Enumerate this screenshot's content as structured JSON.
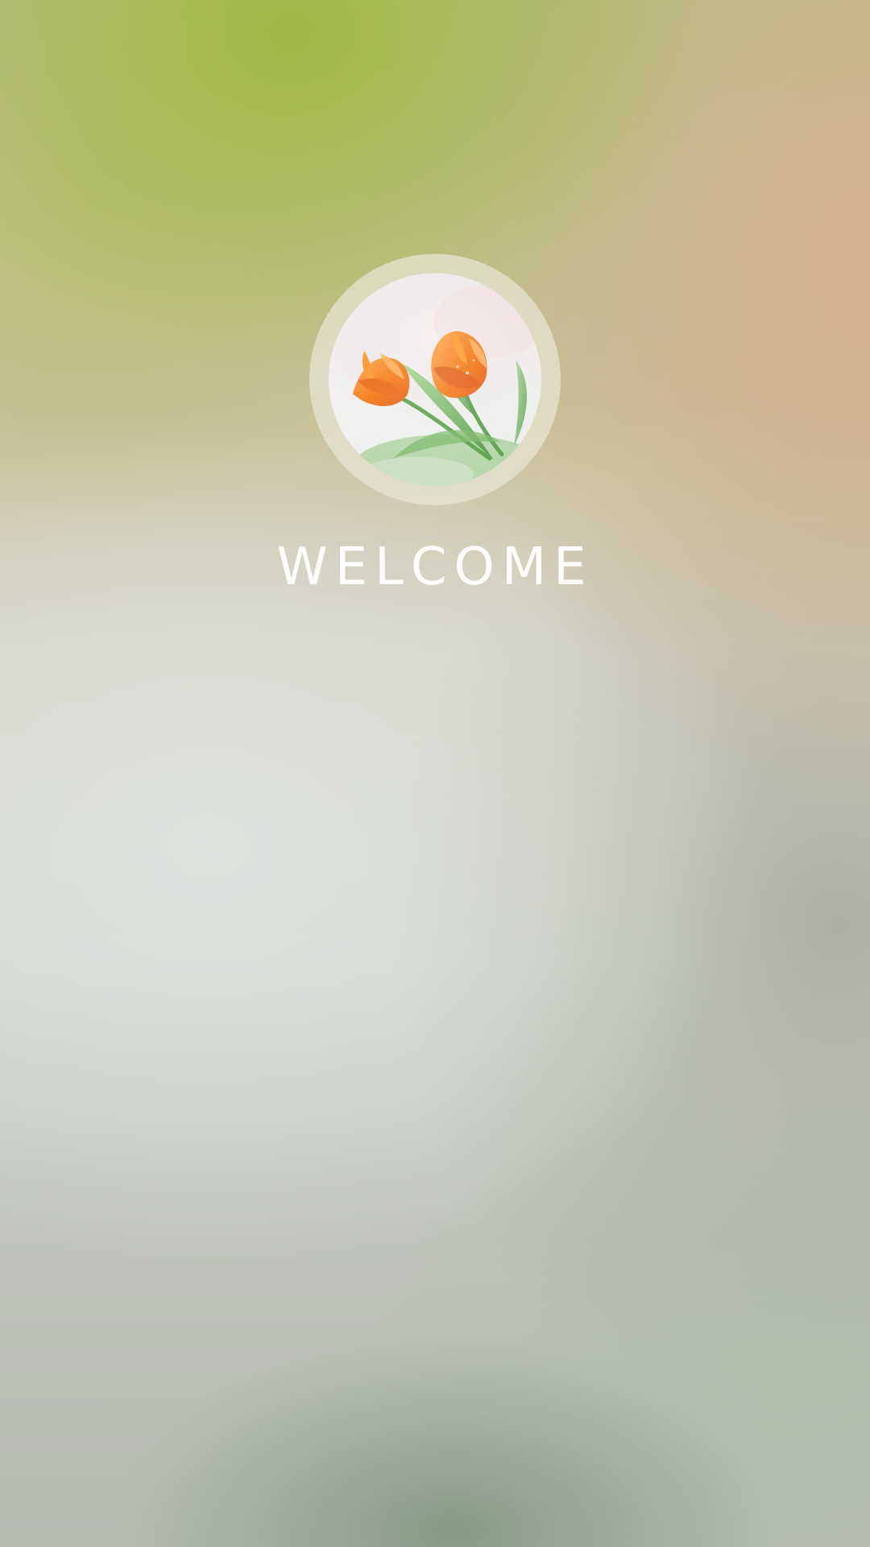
{
  "screen": {
    "welcome_text": "WELCOME"
  },
  "avatar": {
    "icon": "tulip-photo-avatar"
  },
  "colors": {
    "text": "#ffffff",
    "ring": "#e8e6d4",
    "tulip_orange": "#f2841f",
    "leaf_green": "#6fb25a"
  }
}
